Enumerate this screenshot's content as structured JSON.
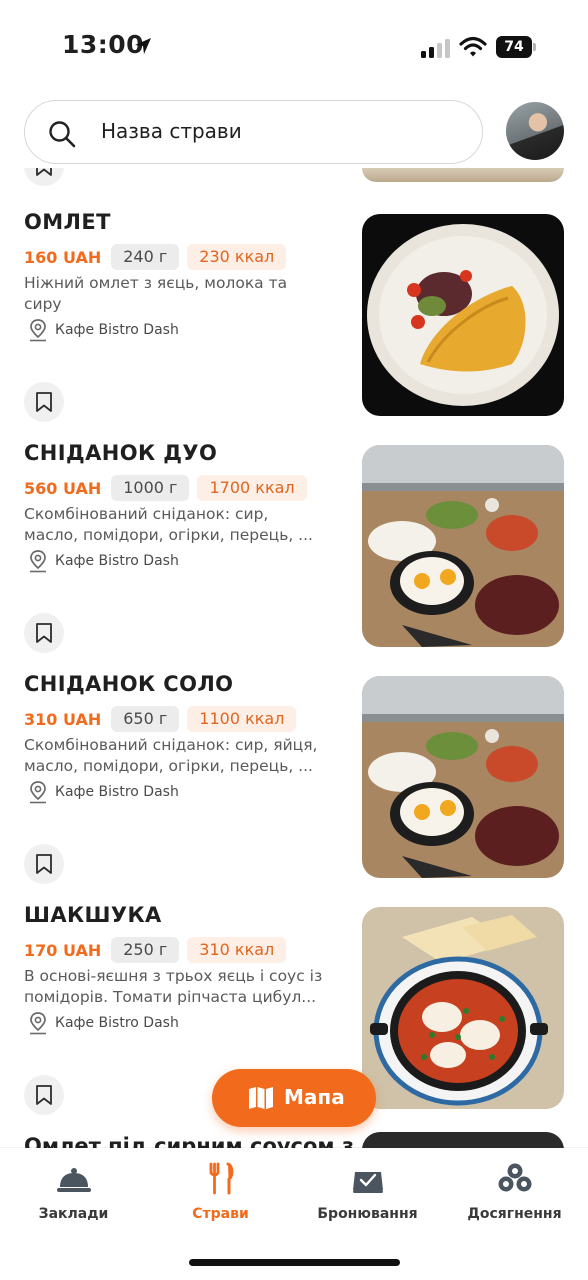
{
  "status_bar": {
    "time": "13:00",
    "battery": "74"
  },
  "search": {
    "placeholder": "Назва страви"
  },
  "dishes": [
    {
      "title": "ОМЛЕТ",
      "price": "160 UAH",
      "weight": "240 г",
      "kcal": "230 ккал",
      "desc_line1": "Ніжний омлет з яєць, молока та",
      "desc_line2": "сиру",
      "place": "Кафе Bistro Dash"
    },
    {
      "title": "СНІДАНОК ДУО",
      "price": "560 UAH",
      "weight": "1000 г",
      "kcal": "1700 ккал",
      "desc_line1": "Скомбінований сніданок: сир,",
      "desc_line2": "масло, помідори, огірки, перець, ...",
      "place": "Кафе Bistro Dash"
    },
    {
      "title": "СНІДАНОК СОЛО",
      "price": "310 UAH",
      "weight": "650 г",
      "kcal": "1100 ккал",
      "desc_line1": "Скомбінований сніданок: сир, яйця,",
      "desc_line2": "масло, помідори, огірки, перець, ...",
      "place": "Кафе Bistro Dash"
    },
    {
      "title": "ШАКШУКА",
      "price": "170 UAH",
      "weight": "250 г",
      "kcal": "310 ккал",
      "desc_line1": "В основі-яєшня з трьох яєць і соус із",
      "desc_line2": "помідорів. Томати ріпчаста цибул...",
      "place": "Кафе Bistro Dash"
    }
  ],
  "next_dish_title": "Омлет під сирним соусом з",
  "map_button": {
    "label": "Мапа"
  },
  "bottom_nav": [
    {
      "label": "Заклади",
      "icon": "cloche-icon"
    },
    {
      "label": "Страви",
      "icon": "fork-knife-icon",
      "active": true
    },
    {
      "label": "Бронювання",
      "icon": "reservation-icon"
    },
    {
      "label": "Досягнення",
      "icon": "achievements-icon"
    }
  ],
  "colors": {
    "accent": "#f26b1d",
    "kcal_bg": "#fdeee6",
    "weight_bg": "#ececec"
  }
}
